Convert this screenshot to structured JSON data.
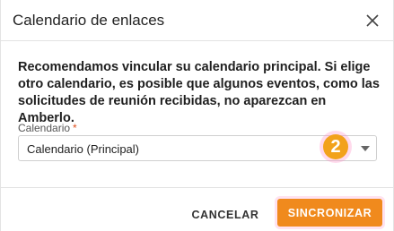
{
  "dialog": {
    "title": "Calendario de enlaces",
    "message": "Recomendamos vincular su calendario principal. Si elige otro calendario, es posible que algunos eventos, como las solicitudes de reunión recibidas, no aparezcan en Amberlo."
  },
  "form": {
    "calendar_label": "Calendario",
    "required_mark": "*",
    "calendar_value": "Calendario (Principal)"
  },
  "annotation": {
    "step_number": "2"
  },
  "footer": {
    "cancel_label": "CANCELAR",
    "sync_label": "SINCRONIZAR"
  },
  "colors": {
    "accent": "#f08a1d",
    "badge": "#f2a21b",
    "required": "#e0501e"
  },
  "icons": {
    "close": "close-icon",
    "dropdown": "chevron-down-icon"
  }
}
